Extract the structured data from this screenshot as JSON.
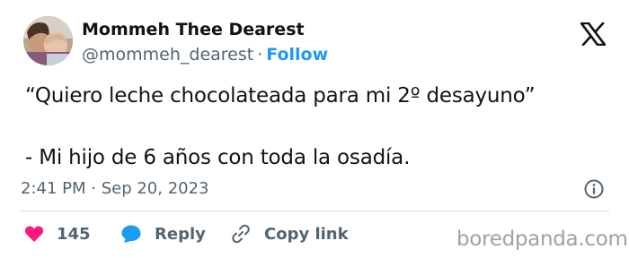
{
  "author": {
    "display_name": "Mommeh Thee Dearest",
    "handle": "@mommeh_dearest",
    "separator": "·",
    "follow_label": "Follow"
  },
  "tweet": {
    "line1": "“Quiero leche chocolateada para mi 2º desayuno”",
    "line2": "- Mi hijo de 6 años con toda la osadía.",
    "timestamp": "2:41 PM · Sep 20, 2023"
  },
  "actions": {
    "likes_count": "145",
    "reply_label": "Reply",
    "copy_link_label": "Copy link"
  },
  "watermark": "boredpanda.com",
  "colors": {
    "link_blue": "#1d9bf0",
    "like_pink": "#f91880",
    "text_gray": "#536471"
  },
  "icons": [
    "x-logo-icon",
    "info-icon",
    "heart-icon",
    "speech-bubble-icon",
    "link-icon"
  ]
}
